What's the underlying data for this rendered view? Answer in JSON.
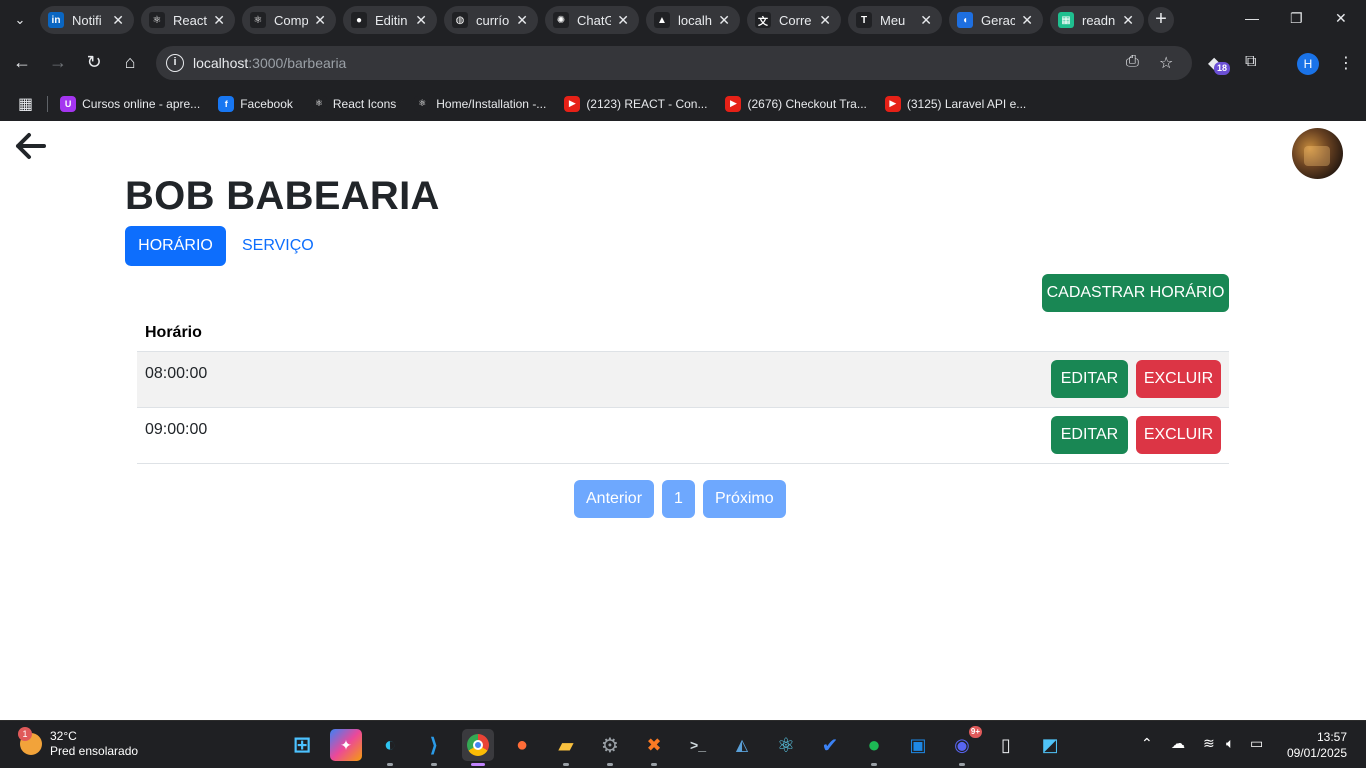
{
  "browser": {
    "tabs": [
      {
        "label": "Notifi",
        "icon": "linkedin-icon",
        "color": "#0a66c2",
        "glyph": "in"
      },
      {
        "label": "React",
        "icon": "react-icon",
        "color": "#202124",
        "glyph": "⚛"
      },
      {
        "label": "Comp",
        "icon": "react-icon",
        "color": "#202124",
        "glyph": "⚛"
      },
      {
        "label": "Editin",
        "icon": "github-icon",
        "color": "#202124",
        "glyph": "●"
      },
      {
        "label": "currío",
        "icon": "globe-icon",
        "color": "#202124",
        "glyph": "◍"
      },
      {
        "label": "ChatG",
        "icon": "chatgpt-icon",
        "color": "#202124",
        "glyph": "✺"
      },
      {
        "label": "localh",
        "icon": "xampp-icon",
        "color": "#202124",
        "glyph": "▲"
      },
      {
        "label": "Corre",
        "icon": "translate-icon",
        "color": "#202124",
        "glyph": "文"
      },
      {
        "label": "Meu",
        "icon": "hammer-icon",
        "color": "#202124",
        "glyph": "T"
      },
      {
        "label": "Gerac",
        "icon": "generator-icon",
        "color": "#1e6fe0",
        "glyph": "◖"
      },
      {
        "label": "readn",
        "icon": "readme-icon",
        "color": "#1fbf8f",
        "glyph": "▦"
      }
    ],
    "url_host": "localhost",
    "url_path": ":3000/barbearia",
    "ext_badge": "18",
    "profile_initial": "H",
    "bookmarks": [
      {
        "label": "Cursos online - apre...",
        "icon": "udemy-icon",
        "color": "#a435f0",
        "glyph": "U"
      },
      {
        "label": "Facebook",
        "icon": "facebook-icon",
        "color": "#1877f2",
        "glyph": "f"
      },
      {
        "label": "React Icons",
        "icon": "react-icons-icon",
        "color": "#202124",
        "glyph": "⚛"
      },
      {
        "label": "Home/Installation -...",
        "icon": "react-icon",
        "color": "#202124",
        "glyph": "⚛"
      },
      {
        "label": "(2123) REACT - Con...",
        "icon": "youtube-icon",
        "color": "#e62117",
        "glyph": "▶"
      },
      {
        "label": "(2676) Checkout Tra...",
        "icon": "youtube-icon",
        "color": "#e62117",
        "glyph": "▶"
      },
      {
        "label": "(3125) Laravel API e...",
        "icon": "youtube-icon",
        "color": "#e62117",
        "glyph": "▶"
      }
    ]
  },
  "page": {
    "title": "BOB BABEARIA",
    "tab_horario": "HORÁRIO",
    "tab_servico": "SERVIÇO",
    "cadastrar_label": "CADASTRAR HORÁRIO",
    "table": {
      "header": "Horário",
      "rows": [
        {
          "time": "08:00:00",
          "edit": "EDITAR",
          "delete": "EXCLUIR"
        },
        {
          "time": "09:00:00",
          "edit": "EDITAR",
          "delete": "EXCLUIR"
        }
      ]
    },
    "pager": {
      "prev": "Anterior",
      "page": "1",
      "next": "Próximo"
    },
    "colors": {
      "primary": "#0d6efd",
      "success": "#198754",
      "danger": "#dc3545",
      "pager": "#6ea8fe"
    }
  },
  "taskbar": {
    "weather_temp": "32°C",
    "weather_desc": "Pred ensolarado",
    "weather_badge": "1",
    "discord_badge": "9+",
    "time": "13:57",
    "date": "09/01/2025"
  }
}
